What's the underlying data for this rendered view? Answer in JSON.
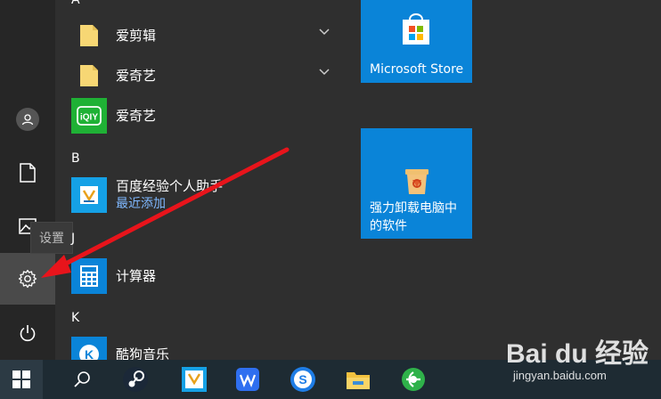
{
  "rail": {
    "tooltip": "设置"
  },
  "apps": {
    "group_a": "A",
    "aijianji": "爱剪辑",
    "aiqiyi_folder": "爱奇艺",
    "aiqiyi": "爱奇艺",
    "group_b": "B",
    "baidu_name": "百度经验个人助手",
    "baidu_badge": "最近添加",
    "group_j": "J",
    "calculator": "计算器",
    "group_k": "K",
    "kugou": "酷狗音乐"
  },
  "tiles": {
    "store_label": "Microsoft Store",
    "uninstall_line1": "强力卸载电脑中",
    "uninstall_line2": "的软件"
  },
  "watermark": {
    "main": "Bai du 经验",
    "sub": "jingyan.baidu.com"
  },
  "colors": {
    "tile_blue": "#0a84d8",
    "accent_link": "#7fb8ff",
    "arrow_red": "#e8141b"
  }
}
